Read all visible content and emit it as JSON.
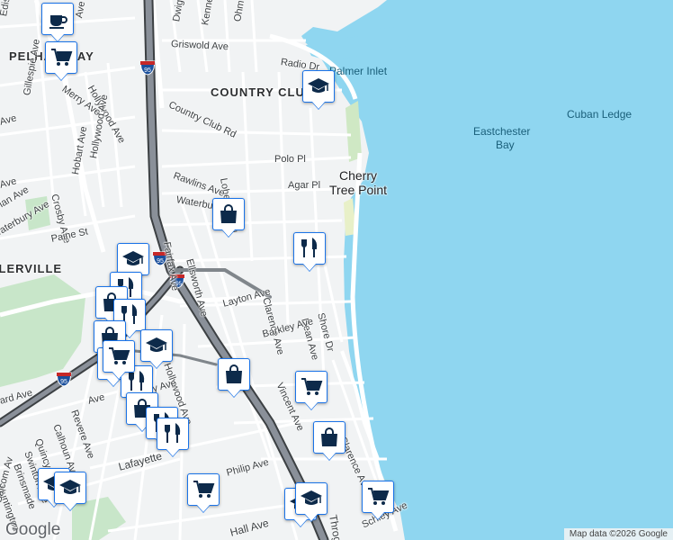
{
  "map": {
    "colors": {
      "water": "#8fd6f0",
      "land": "#f1f3f4",
      "park": "#c8e6c9",
      "highway": "#5f6368",
      "pin_border": "#1a73e8",
      "pin_icon": "#0d2a4a"
    },
    "area_labels": [
      "PELHAM BAY",
      "COUNTRY CLUB",
      "SCHUYLERVILLE"
    ],
    "place_labels": [
      "Cherry",
      "Tree Point"
    ],
    "water_labels": [
      "Eastchester",
      "Bay",
      "Palmer Inlet",
      "Cuban Ledge"
    ],
    "street_labels": [
      "Edison Ave",
      "Ave",
      "Dwight",
      "Kennellworth",
      "Ohm Av",
      "Griswold Ave",
      "Radio Dr",
      "Merry Ave",
      "Hollywood Ave",
      "Gillespie Ave",
      "Country Club Rd",
      "Hollywood Ave",
      "Lohengrin Pl",
      "Polo Pl",
      "Rawlins Ave",
      "Agar Pl",
      "Hobart Ave",
      "Crosby Ave",
      "Waterbury",
      "Fairfax Ave",
      "Ellsworth Ave",
      "Paine St",
      "Waterbury Ave",
      "Clarence Ave",
      "Dean Ave",
      "Shore Dr",
      "Layton Ave",
      "Barkley Ave",
      "Hollywood Ave",
      "Vincent Ave",
      "Clarence Ave",
      "Revere Ave",
      "Calhoun Ave",
      "Quincy Ave",
      "Swinton Ave",
      "Brinsmade",
      "Huntington",
      "Balcom Av",
      "Lafayette",
      "Philip Ave",
      "Hall Ave",
      "Throgs",
      "Schley Ave",
      "Ave",
      "ard Ave",
      "Ave",
      "Ave",
      "lan Ave",
      "ey Ave",
      "Ave"
    ],
    "highway_shields": [
      "95",
      "95",
      "695",
      "95"
    ],
    "markers": [
      {
        "type": "coffee",
        "label": "cafe"
      },
      {
        "type": "shopping-cart",
        "label": "grocery"
      },
      {
        "type": "school",
        "label": "school"
      },
      {
        "type": "shopping-bag",
        "label": "store"
      },
      {
        "type": "restaurant",
        "label": "restaurant"
      },
      {
        "type": "school",
        "label": "school"
      },
      {
        "type": "restaurant",
        "label": "restaurant"
      },
      {
        "type": "shopping-bag",
        "label": "store"
      },
      {
        "type": "restaurant",
        "label": "restaurant"
      },
      {
        "type": "shopping-bag",
        "label": "store"
      },
      {
        "type": "school",
        "label": "school"
      },
      {
        "type": "shopping-cart",
        "label": "grocery"
      },
      {
        "type": "shopping-bag",
        "label": "store"
      },
      {
        "type": "restaurant",
        "label": "restaurant"
      },
      {
        "type": "shopping-cart",
        "label": "grocery"
      },
      {
        "type": "shopping-bag",
        "label": "store"
      },
      {
        "type": "restaurant",
        "label": "restaurant"
      },
      {
        "type": "restaurant",
        "label": "restaurant"
      },
      {
        "type": "shopping-cart",
        "label": "grocery"
      },
      {
        "type": "shopping-bag",
        "label": "store"
      },
      {
        "type": "school",
        "label": "school"
      },
      {
        "type": "school",
        "label": "school"
      },
      {
        "type": "shopping-cart",
        "label": "grocery"
      },
      {
        "type": "school",
        "label": "school"
      },
      {
        "type": "school",
        "label": "school"
      },
      {
        "type": "shopping-cart",
        "label": "grocery"
      }
    ],
    "logo": "Google",
    "attribution": "Map data ©2026 Google"
  }
}
